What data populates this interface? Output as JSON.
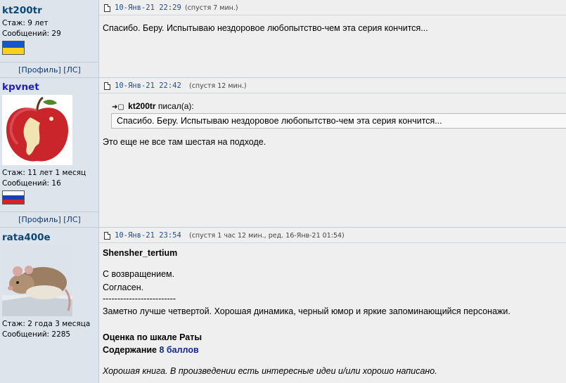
{
  "posts": [
    {
      "user": {
        "nick": "kt200tr",
        "stage": "Стаж: 9 лет",
        "messages": "Сообщений: 29",
        "flag": "ukraine-flag",
        "profile_link": "[Профиль]",
        "pm_link": "[ЛС]"
      },
      "date": "10-Янв-21 22:29",
      "ago": "(спустя 7 мин.)",
      "body": "Спасибо. Беру. Испытываю нездоровое любопытство-чем эта серия кончится..."
    },
    {
      "user": {
        "nick": "kpvnet",
        "stage": "Стаж: 11 лет 1 месяц",
        "messages": "Сообщений: 16",
        "flag": "russia-flag",
        "profile_link": "[Профиль]",
        "pm_link": "[ЛС]"
      },
      "date": "10-Янв-21 22:42",
      "ago": "(спустя 12 мин.)",
      "quote_author": "kt200tr",
      "quote_wrote": "писал(а):",
      "quote_text": "Спасибо. Беру. Испытываю нездоровое любопытство-чем эта серия кончится...",
      "body": "Это еще не все там шестая на подходе."
    },
    {
      "user": {
        "nick": "rata400e",
        "stage": "Стаж: 2 года 3 месяца",
        "messages": "Сообщений: 2285"
      },
      "date": "10-Янв-21 23:54",
      "ago": "(спустя 1 час 12 мин., ред. 16-Янв-21 01:54)",
      "addressee": "Shensher_tertium",
      "line1": "С возвращением.",
      "line2": "Согласен.",
      "dashes": "-------------------------",
      "review": "Заметно лучше четвертой. Хорошая динамика, черный юмор и яркие запоминающийся персонажи.",
      "rating_title": "Оценка по шкале Раты",
      "rating_label": "Содержание",
      "rating_value": "8 баллов",
      "verdict": "Хорошая книга. В произведении есть интересные идеи и/или хорошо написано."
    }
  ],
  "colors": {
    "user_panel": "#DDE4EC",
    "post_panel": "#EFEFEF",
    "nick": "#0A4876",
    "date": "#1F4F8F"
  }
}
